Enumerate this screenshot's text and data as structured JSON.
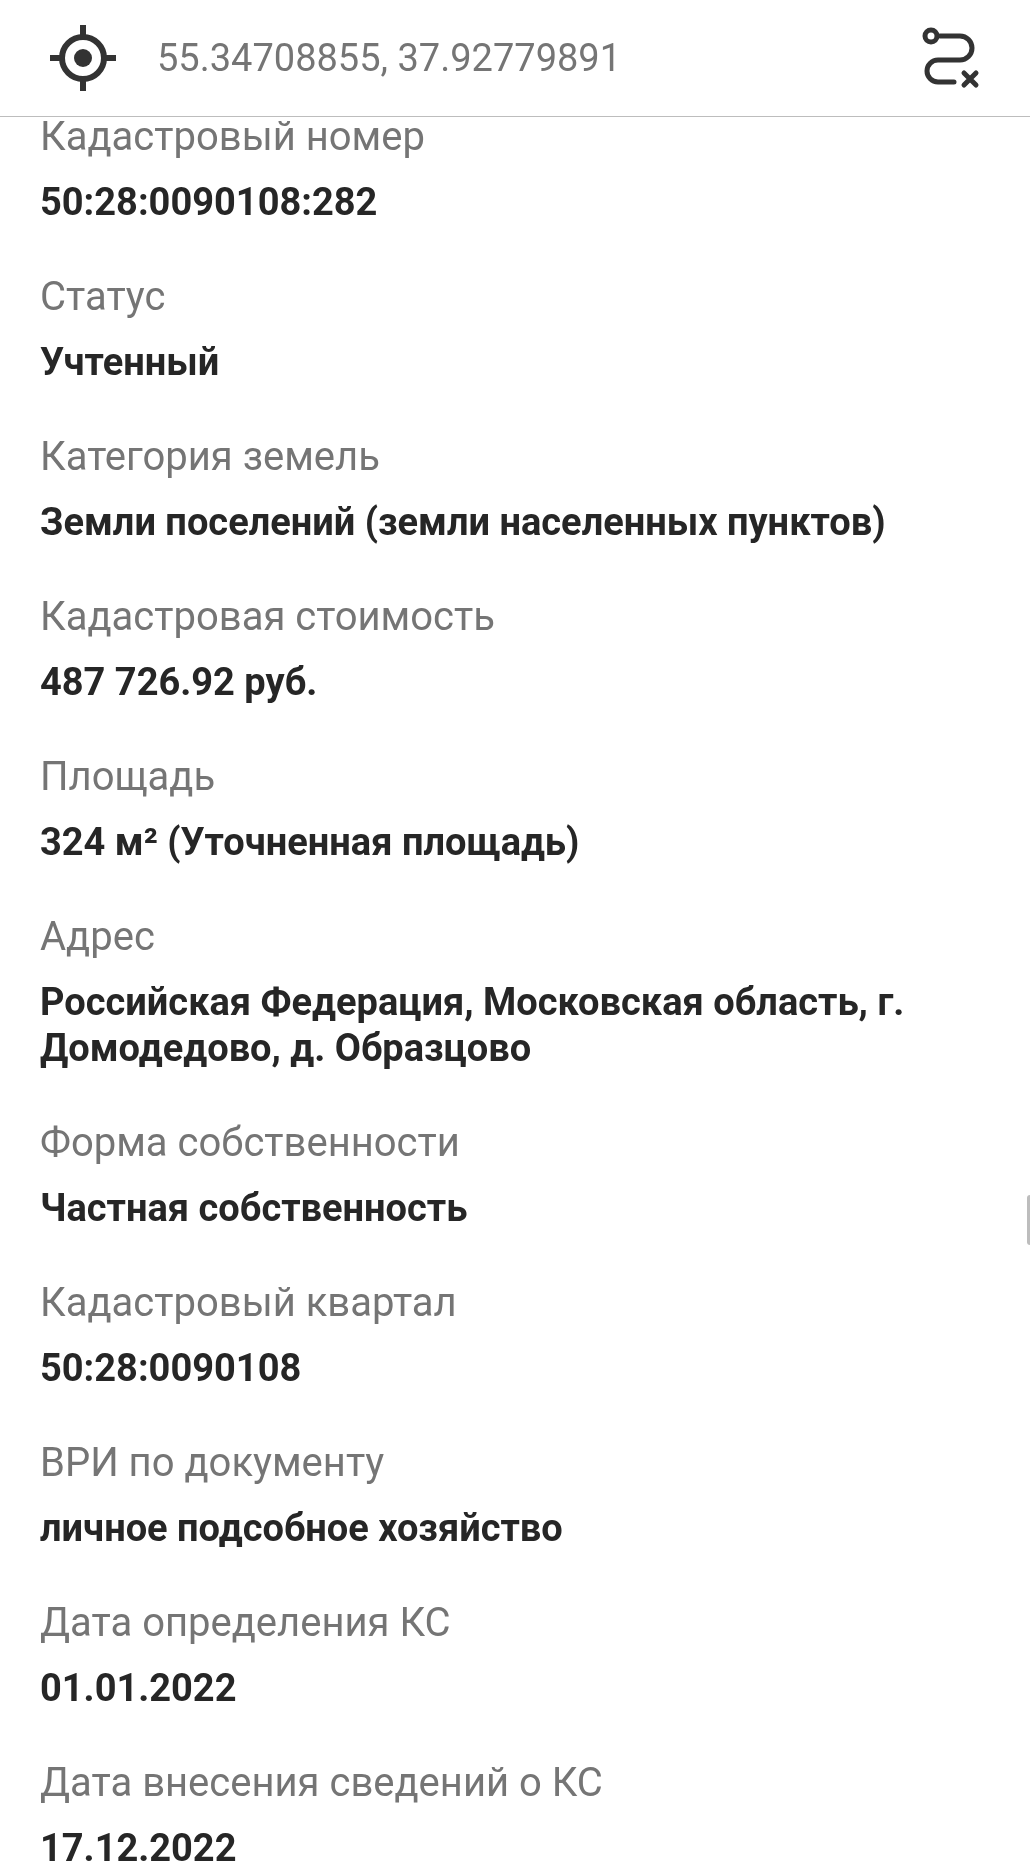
{
  "header": {
    "coordinates": "55.34708855, 37.92779891"
  },
  "fields": [
    {
      "label": "Кадастровый номер",
      "value": "50:28:0090108:282"
    },
    {
      "label": "Статус",
      "value": "Учтенный"
    },
    {
      "label": "Категория земель",
      "value": "Земли поселений (земли населенных пунктов)"
    },
    {
      "label": "Кадастровая стоимость",
      "value": "487 726.92 руб."
    },
    {
      "label": "Площадь",
      "value": "324 м² (Уточненная площадь)"
    },
    {
      "label": "Адрес",
      "value": "Российская Федерация, Московская область, г. Домодедово, д. Образцово"
    },
    {
      "label": "Форма собственности",
      "value": "Частная собственность"
    },
    {
      "label": "Кадастровый квартал",
      "value": "50:28:0090108"
    },
    {
      "label": "ВРИ по документу",
      "value": "личное подсобное хозяйство"
    },
    {
      "label": "Дата определения КС",
      "value": "01.01.2022"
    },
    {
      "label": "Дата внесения сведений о КС",
      "value": "17.12.2022"
    }
  ]
}
